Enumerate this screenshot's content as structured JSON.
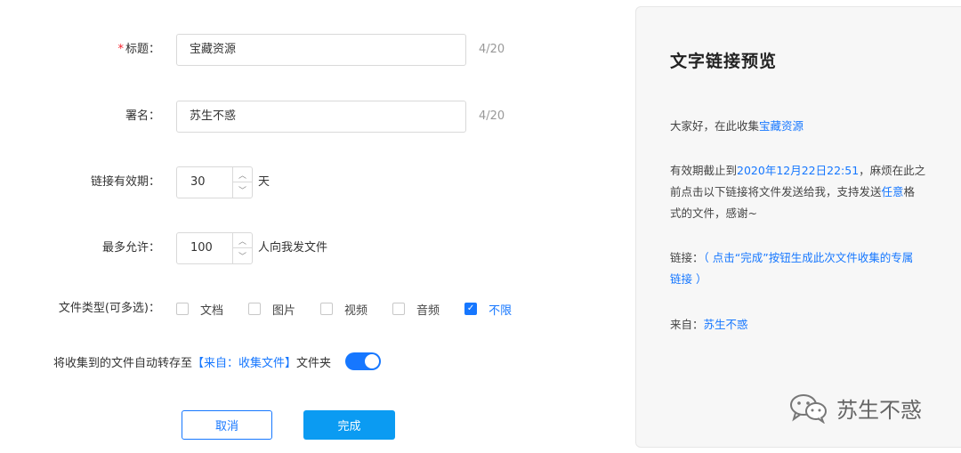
{
  "form": {
    "title": {
      "required_mark": "*",
      "label": "标题：",
      "value": "宝藏资源",
      "counter": "4/20"
    },
    "signature": {
      "label": "署名：",
      "value": "苏生不惑",
      "counter": "4/20"
    },
    "validity": {
      "label": "链接有效期：",
      "value": "30",
      "unit": "天"
    },
    "max_allow": {
      "label": "最多允许：",
      "value": "100",
      "unit": "人向我发文件"
    },
    "file_types": {
      "label": "文件类型(可多选)：",
      "options": [
        {
          "label": "文档",
          "checked": false
        },
        {
          "label": "图片",
          "checked": false
        },
        {
          "label": "视频",
          "checked": false
        },
        {
          "label": "音频",
          "checked": false
        },
        {
          "label": "不限",
          "checked": true
        }
      ]
    },
    "auto_save": {
      "prefix": "将收集到的文件自动转存至",
      "folder": "【来自：收集文件】",
      "suffix": "文件夹",
      "enabled": true
    },
    "cancel_label": "取消",
    "done_label": "完成"
  },
  "preview": {
    "title": "文字链接预览",
    "greeting_prefix": "大家好，在此收集",
    "greeting_highlight": "宝藏资源",
    "deadline_prefix": "有效期截止到",
    "deadline_highlight": "2020年12月22日22:51",
    "deadline_line1_tail": "，麻烦在此之",
    "deadline_line2": "前点击以下链接将文件发送给我，支持发送",
    "deadline_any": "任意",
    "deadline_line2_tail": "格",
    "deadline_line3": "式的文件，感谢~",
    "link_label": "链接：",
    "link_text_line1": "（ 点击“完成”按钮生成此次文件收集的专属",
    "link_text_line2": "链接 ）",
    "from_label": "来自：",
    "from_value": "苏生不惑"
  },
  "watermark": {
    "text": "苏生不惑",
    "icon": "wechat-icon"
  },
  "colors": {
    "accent": "#1677ff",
    "primary_button": "#0b9bf2",
    "required": "#f5222d"
  }
}
